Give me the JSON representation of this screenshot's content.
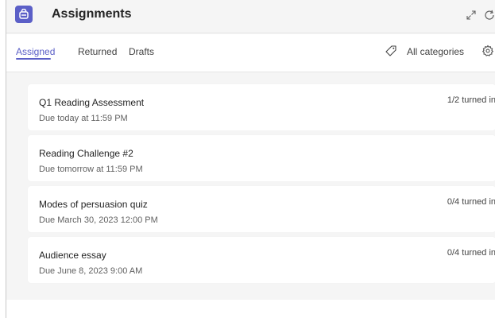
{
  "header": {
    "title": "Assignments",
    "icons": [
      "assignments-bag-icon",
      "expand-icon",
      "refresh-icon"
    ]
  },
  "tabs": [
    {
      "label": "Assigned",
      "active": true
    },
    {
      "label": "Returned",
      "active": false
    },
    {
      "label": "Drafts",
      "active": false
    }
  ],
  "filters": {
    "categories_label": "All categories",
    "icons": [
      "tag-icon",
      "settings-icon"
    ]
  },
  "assignments": [
    {
      "title": "Q1 Reading Assessment",
      "due": "Due today at 11:59 PM",
      "status": "1/2 turned in"
    },
    {
      "title": "Reading Challenge #2",
      "due": "Due tomorrow at 11:59 PM",
      "status": ""
    },
    {
      "title": "Modes of persuasion quiz",
      "due": "Due March 30, 2023 12:00 PM",
      "status": "0/4 turned in"
    },
    {
      "title": "Audience essay",
      "due": "Due June 8, 2023 9:00 AM",
      "status": "0/4 turned in"
    }
  ],
  "colors": {
    "accent": "#5b5fc7",
    "background": "#f5f5f5",
    "card": "#ffffff",
    "text": "#242424",
    "muted": "#616161"
  }
}
